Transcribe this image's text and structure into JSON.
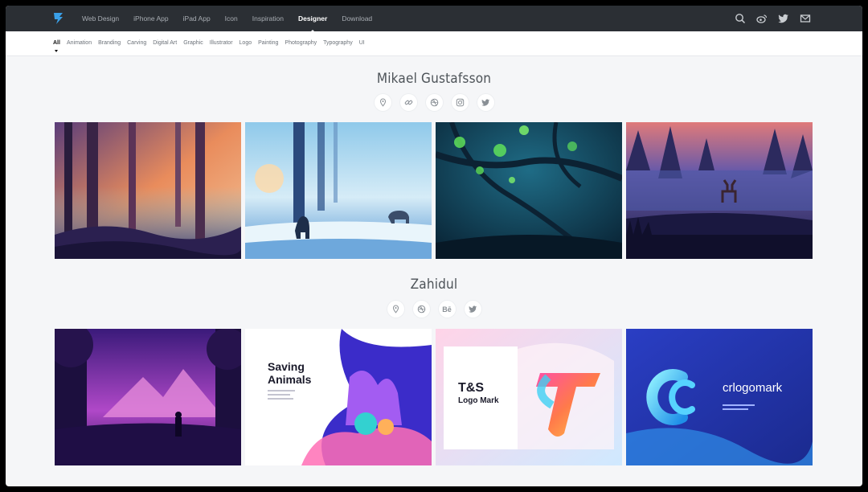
{
  "nav": {
    "items": [
      "Web Design",
      "iPhone App",
      "iPad App",
      "Icon",
      "Inspiration",
      "Designer",
      "Download"
    ],
    "active_index": 5,
    "icons": [
      "search-icon",
      "weibo-icon",
      "twitter-icon",
      "mail-icon"
    ]
  },
  "categories": {
    "items": [
      "All",
      "Animation",
      "Branding",
      "Carving",
      "Digital Art",
      "Graphic",
      "Illustrator",
      "Logo",
      "Painting",
      "Photography",
      "Typography",
      "UI"
    ],
    "active_index": 0
  },
  "designers": [
    {
      "name": "Mikael Gustafsson",
      "socials": [
        "location-icon",
        "link-icon",
        "dribbble-icon",
        "instagram-icon",
        "twitter-icon"
      ],
      "works": [
        "forest-sunset-artwork",
        "snow-bear-artwork",
        "green-lights-artwork",
        "deer-forest-artwork"
      ]
    },
    {
      "name": "Zahidul",
      "socials": [
        "location-icon",
        "dribbble-icon",
        "behance-icon",
        "twitter-icon"
      ],
      "behance_label": "Bē",
      "works": [
        "purple-mountain-artwork",
        "saving-animals-artwork",
        "ts-logo-mark-artwork",
        "crlogomark-artwork"
      ],
      "tile_text": {
        "saving_title_1": "Saving",
        "saving_title_2": "Animals",
        "ts_title": "T&S",
        "ts_subtitle": "Logo Mark",
        "crlogomark": "crlogomark"
      }
    }
  ],
  "colors": {
    "nav_bg": "#2b2f34",
    "accent_logo": "#3aa0e8",
    "page_bg": "#f5f6f8"
  }
}
